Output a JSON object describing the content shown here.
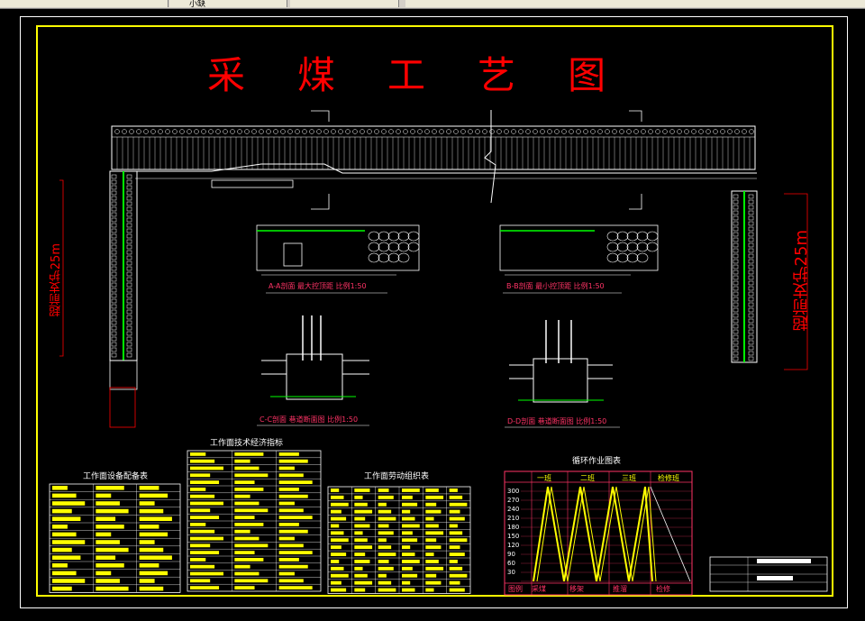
{
  "toolbar": {
    "text": "小缺"
  },
  "title": {
    "chars": [
      "采",
      "煤",
      "工",
      "艺",
      "图"
    ]
  },
  "section_captions": {
    "aa": "A-A剖面  最大控顶距  比例1:50",
    "bb": "B-B剖面  最小控顶距  比例1:50",
    "cc": "C-C剖面  巷道断面图  比例1:50",
    "dd": "D-D剖面  巷道断面图  比例1:50"
  },
  "left_support_label": "超前支护25m",
  "right_support_label": "超前支护25m",
  "tables": {
    "equipment": "工作面设备配备表",
    "indicators": "工作面技术经济指标",
    "labor": "工作面劳动组织表",
    "cycle": "循环作业图表"
  },
  "cycle_chart": {
    "shifts": [
      "一班",
      "二班",
      "三班",
      "检修班"
    ],
    "y_ticks": [
      "300",
      "270",
      "240",
      "210",
      "180",
      "150",
      "120",
      "90",
      "60",
      "30"
    ],
    "footer": [
      "图例",
      "采煤",
      "移架",
      "推溜",
      "检修"
    ]
  },
  "colors": {
    "frame": "#ffff00",
    "title": "#ff0000",
    "label": "#ff3366",
    "line": "#ffffff",
    "fill": "#ffff00"
  }
}
